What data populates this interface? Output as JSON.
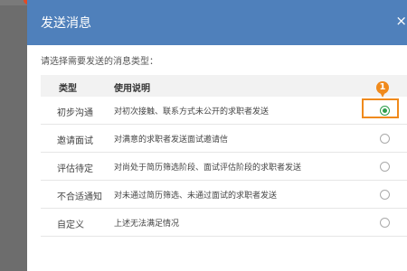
{
  "dialog": {
    "title": "发送消息",
    "close_label": "×"
  },
  "prompt": "请选择需要发送的消息类型：",
  "table": {
    "headers": {
      "type": "类型",
      "desc": "使用说明"
    },
    "rows": [
      {
        "type": "初步沟通",
        "desc": "对初次接触、联系方式未公开的求职者发送",
        "selected": true
      },
      {
        "type": "邀请面试",
        "desc": "对满意的求职者发送面试邀请信",
        "selected": false
      },
      {
        "type": "评估待定",
        "desc": "对尚处于简历筛选阶段、面试评估阶段的求职者发送",
        "selected": false
      },
      {
        "type": "不合适通知",
        "desc": "对未通过简历筛选、未通过面试的求职者发送",
        "selected": false
      },
      {
        "type": "自定义",
        "desc": "上述无法满足情况",
        "selected": false
      }
    ]
  },
  "annotation": {
    "step": "1",
    "color": "#f08a1c"
  },
  "colors": {
    "header": "#4f80bb",
    "radio_selected": "#2e9e4a",
    "overlay": "#6d6d6d"
  }
}
